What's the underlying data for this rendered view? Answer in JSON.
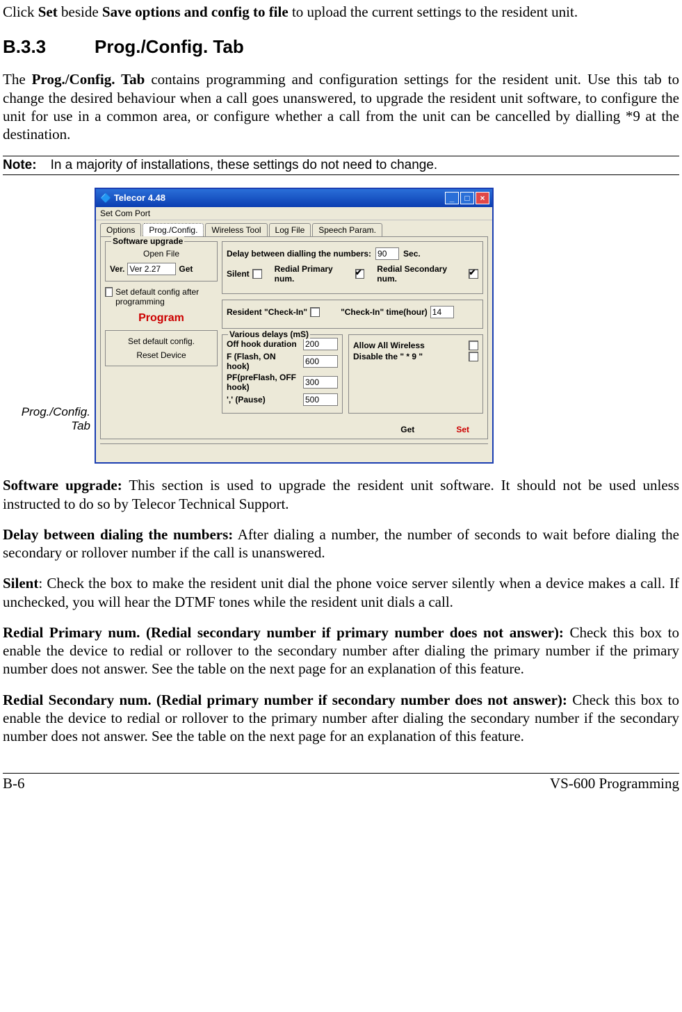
{
  "top_para": {
    "p1": "Click ",
    "b1": "Set",
    "p2": " beside ",
    "b2": "Save options and config to file",
    "p3": " to upload the current settings to the resident unit."
  },
  "heading": {
    "num": "B.3.3",
    "title": "Prog./Config. Tab"
  },
  "intro": {
    "p1": "The ",
    "b1": "Prog./Config. Tab",
    "p2": " contains programming and configuration settings for the resident unit. Use this tab to change the desired behaviour when a call goes unanswered, to upgrade the resident unit software, to configure the unit for use in a common area, or configure whether a call from the unit can be cancelled by dialling *9 at the destination."
  },
  "note": {
    "label": "Note:",
    "text": "In a majority of installations, these settings do not need to change."
  },
  "fig_caption": "Prog./Config. Tab",
  "window": {
    "title": "Telecor 4.48",
    "menu": "Set Com Port",
    "tabs": [
      "Options",
      "Prog./Config.",
      "Wireless Tool",
      "Log File",
      "Speech Param."
    ],
    "active_tab_index": 1,
    "left": {
      "group1_title": "Software upgrade",
      "open_file": "Open File",
      "ver_label": "Ver.",
      "ver_value": "Ver 2.27",
      "get": "Get",
      "default_after": "Set default config after programming",
      "program": "Program",
      "set_default": "Set default config.",
      "reset": "Reset Device"
    },
    "right": {
      "delay_label": "Delay between dialling the numbers:",
      "delay_value": "90",
      "sec": "Sec.",
      "silent": "Silent",
      "redial_primary": "Redial Primary num.",
      "redial_secondary": "Redial Secondary num.",
      "checkin_label": "Resident \"Check-In\"",
      "checkin_time_label": "\"Check-In\" time(hour)",
      "checkin_time_value": "14",
      "delays_title": "Various delays (mS)",
      "offhook": "Off hook duration",
      "offhook_v": "200",
      "flash": "F (Flash, ON hook)",
      "flash_v": "600",
      "preflash": "PF(preFlash, OFF hook)",
      "preflash_v": "300",
      "pause": "',' (Pause)",
      "pause_v": "500",
      "allow_wireless": "Allow All Wireless",
      "disable_star9": "Disable the \" * 9 \"",
      "get": "Get",
      "set": "Set"
    }
  },
  "body1": {
    "b": "Software upgrade:",
    "t": " This section is used to upgrade the resident unit software.  It should not be used unless instructed to do so by Telecor Technical Support."
  },
  "body2": {
    "b": "Delay between dialing the numbers:",
    "t": " After dialing a number, the number of seconds to wait before dialing the secondary or rollover number if the call is unanswered."
  },
  "body3": {
    "b": "Silent",
    "t": ": Check the box to make the resident unit dial the phone voice server silently when a device makes a call.  If unchecked, you will hear the DTMF tones while the resident unit dials a call."
  },
  "body4": {
    "b": "Redial Primary num. (Redial secondary number if primary number does not answer):",
    "t": " Check this box to enable the device to redial or rollover to the secondary number after dialing the primary number if the primary number does not answer.  See the table on the next page for an explanation of this feature."
  },
  "body5": {
    "b": "Redial Secondary num. (Redial primary number if secondary number does not answer):",
    "t": " Check this box to enable the device to redial or rollover to the primary number after dialing the secondary number if the secondary number does not answer.  See the table on the next page for an explanation of this feature."
  },
  "footer": {
    "left": "B-6",
    "right": "VS-600 Programming"
  }
}
